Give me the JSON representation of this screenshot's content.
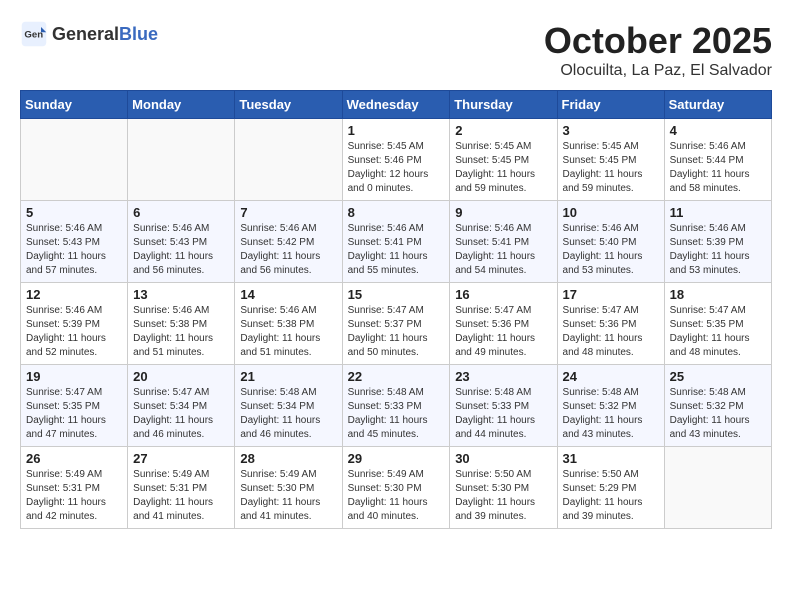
{
  "header": {
    "logo_general": "General",
    "logo_blue": "Blue",
    "month": "October 2025",
    "location": "Olocuilta, La Paz, El Salvador"
  },
  "weekdays": [
    "Sunday",
    "Monday",
    "Tuesday",
    "Wednesday",
    "Thursday",
    "Friday",
    "Saturday"
  ],
  "weeks": [
    [
      {
        "day": "",
        "info": ""
      },
      {
        "day": "",
        "info": ""
      },
      {
        "day": "",
        "info": ""
      },
      {
        "day": "1",
        "info": "Sunrise: 5:45 AM\nSunset: 5:46 PM\nDaylight: 12 hours\nand 0 minutes."
      },
      {
        "day": "2",
        "info": "Sunrise: 5:45 AM\nSunset: 5:45 PM\nDaylight: 11 hours\nand 59 minutes."
      },
      {
        "day": "3",
        "info": "Sunrise: 5:45 AM\nSunset: 5:45 PM\nDaylight: 11 hours\nand 59 minutes."
      },
      {
        "day": "4",
        "info": "Sunrise: 5:46 AM\nSunset: 5:44 PM\nDaylight: 11 hours\nand 58 minutes."
      }
    ],
    [
      {
        "day": "5",
        "info": "Sunrise: 5:46 AM\nSunset: 5:43 PM\nDaylight: 11 hours\nand 57 minutes."
      },
      {
        "day": "6",
        "info": "Sunrise: 5:46 AM\nSunset: 5:43 PM\nDaylight: 11 hours\nand 56 minutes."
      },
      {
        "day": "7",
        "info": "Sunrise: 5:46 AM\nSunset: 5:42 PM\nDaylight: 11 hours\nand 56 minutes."
      },
      {
        "day": "8",
        "info": "Sunrise: 5:46 AM\nSunset: 5:41 PM\nDaylight: 11 hours\nand 55 minutes."
      },
      {
        "day": "9",
        "info": "Sunrise: 5:46 AM\nSunset: 5:41 PM\nDaylight: 11 hours\nand 54 minutes."
      },
      {
        "day": "10",
        "info": "Sunrise: 5:46 AM\nSunset: 5:40 PM\nDaylight: 11 hours\nand 53 minutes."
      },
      {
        "day": "11",
        "info": "Sunrise: 5:46 AM\nSunset: 5:39 PM\nDaylight: 11 hours\nand 53 minutes."
      }
    ],
    [
      {
        "day": "12",
        "info": "Sunrise: 5:46 AM\nSunset: 5:39 PM\nDaylight: 11 hours\nand 52 minutes."
      },
      {
        "day": "13",
        "info": "Sunrise: 5:46 AM\nSunset: 5:38 PM\nDaylight: 11 hours\nand 51 minutes."
      },
      {
        "day": "14",
        "info": "Sunrise: 5:46 AM\nSunset: 5:38 PM\nDaylight: 11 hours\nand 51 minutes."
      },
      {
        "day": "15",
        "info": "Sunrise: 5:47 AM\nSunset: 5:37 PM\nDaylight: 11 hours\nand 50 minutes."
      },
      {
        "day": "16",
        "info": "Sunrise: 5:47 AM\nSunset: 5:36 PM\nDaylight: 11 hours\nand 49 minutes."
      },
      {
        "day": "17",
        "info": "Sunrise: 5:47 AM\nSunset: 5:36 PM\nDaylight: 11 hours\nand 48 minutes."
      },
      {
        "day": "18",
        "info": "Sunrise: 5:47 AM\nSunset: 5:35 PM\nDaylight: 11 hours\nand 48 minutes."
      }
    ],
    [
      {
        "day": "19",
        "info": "Sunrise: 5:47 AM\nSunset: 5:35 PM\nDaylight: 11 hours\nand 47 minutes."
      },
      {
        "day": "20",
        "info": "Sunrise: 5:47 AM\nSunset: 5:34 PM\nDaylight: 11 hours\nand 46 minutes."
      },
      {
        "day": "21",
        "info": "Sunrise: 5:48 AM\nSunset: 5:34 PM\nDaylight: 11 hours\nand 46 minutes."
      },
      {
        "day": "22",
        "info": "Sunrise: 5:48 AM\nSunset: 5:33 PM\nDaylight: 11 hours\nand 45 minutes."
      },
      {
        "day": "23",
        "info": "Sunrise: 5:48 AM\nSunset: 5:33 PM\nDaylight: 11 hours\nand 44 minutes."
      },
      {
        "day": "24",
        "info": "Sunrise: 5:48 AM\nSunset: 5:32 PM\nDaylight: 11 hours\nand 43 minutes."
      },
      {
        "day": "25",
        "info": "Sunrise: 5:48 AM\nSunset: 5:32 PM\nDaylight: 11 hours\nand 43 minutes."
      }
    ],
    [
      {
        "day": "26",
        "info": "Sunrise: 5:49 AM\nSunset: 5:31 PM\nDaylight: 11 hours\nand 42 minutes."
      },
      {
        "day": "27",
        "info": "Sunrise: 5:49 AM\nSunset: 5:31 PM\nDaylight: 11 hours\nand 41 minutes."
      },
      {
        "day": "28",
        "info": "Sunrise: 5:49 AM\nSunset: 5:30 PM\nDaylight: 11 hours\nand 41 minutes."
      },
      {
        "day": "29",
        "info": "Sunrise: 5:49 AM\nSunset: 5:30 PM\nDaylight: 11 hours\nand 40 minutes."
      },
      {
        "day": "30",
        "info": "Sunrise: 5:50 AM\nSunset: 5:30 PM\nDaylight: 11 hours\nand 39 minutes."
      },
      {
        "day": "31",
        "info": "Sunrise: 5:50 AM\nSunset: 5:29 PM\nDaylight: 11 hours\nand 39 minutes."
      },
      {
        "day": "",
        "info": ""
      }
    ]
  ]
}
